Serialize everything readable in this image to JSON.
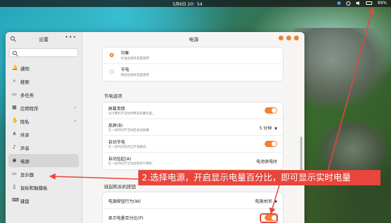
{
  "topbar": {
    "clock": "3月6日  20：54",
    "battery": "99%"
  },
  "sidebar": {
    "title": "设置",
    "menu": "•••",
    "items": [
      {
        "label": "通知",
        "icon": "bell-icon",
        "glyph": "🔔"
      },
      {
        "label": "搜索",
        "icon": "search-icon",
        "glyph": "⌕"
      },
      {
        "label": "多任务",
        "icon": "multitask-icon",
        "glyph": "▭"
      },
      {
        "label": "应用程序",
        "icon": "apps-icon",
        "glyph": "▦",
        "chevron": true
      },
      {
        "label": "隐私",
        "icon": "hand-icon",
        "glyph": "✋",
        "chevron": true
      },
      {
        "label": "共享",
        "icon": "share-icon",
        "glyph": "⋔"
      },
      {
        "label": "声音",
        "icon": "sound-icon",
        "glyph": "♪"
      },
      {
        "label": "电源",
        "icon": "power-icon",
        "glyph": "◉",
        "active": true
      },
      {
        "label": "显示器",
        "icon": "display-icon",
        "glyph": "▭"
      },
      {
        "label": "鼠标和触摸板",
        "icon": "mouse-icon",
        "glyph": "▯"
      },
      {
        "label": "键盘",
        "icon": "keyboard-icon",
        "glyph": "⌨"
      }
    ]
  },
  "main": {
    "title": "电源",
    "power_mode": [
      {
        "label": "均衡",
        "desc": "标准性能和电量使用",
        "selected": true
      },
      {
        "label": "节电",
        "desc": "降低性能和电量使用",
        "selected": false
      }
    ],
    "power_saving_title": "节电选项",
    "power_saving": [
      {
        "label": "屏幕变暗",
        "desc": "设计算机不活动时降低屏幕亮度。",
        "control": "toggle"
      },
      {
        "label": "息屏(B)",
        "desc": "在一段时间不活动后关闭屏幕",
        "control": "dropdown",
        "value": "5 分钟"
      },
      {
        "label": "自动节电",
        "desc": "在一段时间后开启节电模式。",
        "control": "toggle"
      },
      {
        "label": "自动挂起(A)",
        "desc": "在一段时间不活动后暂停计算机",
        "control": "dropdown",
        "value": "电池供电时"
      }
    ],
    "suspend_title": "挂起和关机按钮",
    "suspend": [
      {
        "label": "电源按钮行为(W)",
        "control": "dropdown",
        "value": "电源关闭"
      },
      {
        "label": "显示电量百分比(P)",
        "control": "toggle"
      }
    ]
  },
  "annotation": {
    "text": "2.选择电源，开启显示电量百分比，即可显示实时电量",
    "color": "#e8463c"
  },
  "accent": "#f08132"
}
